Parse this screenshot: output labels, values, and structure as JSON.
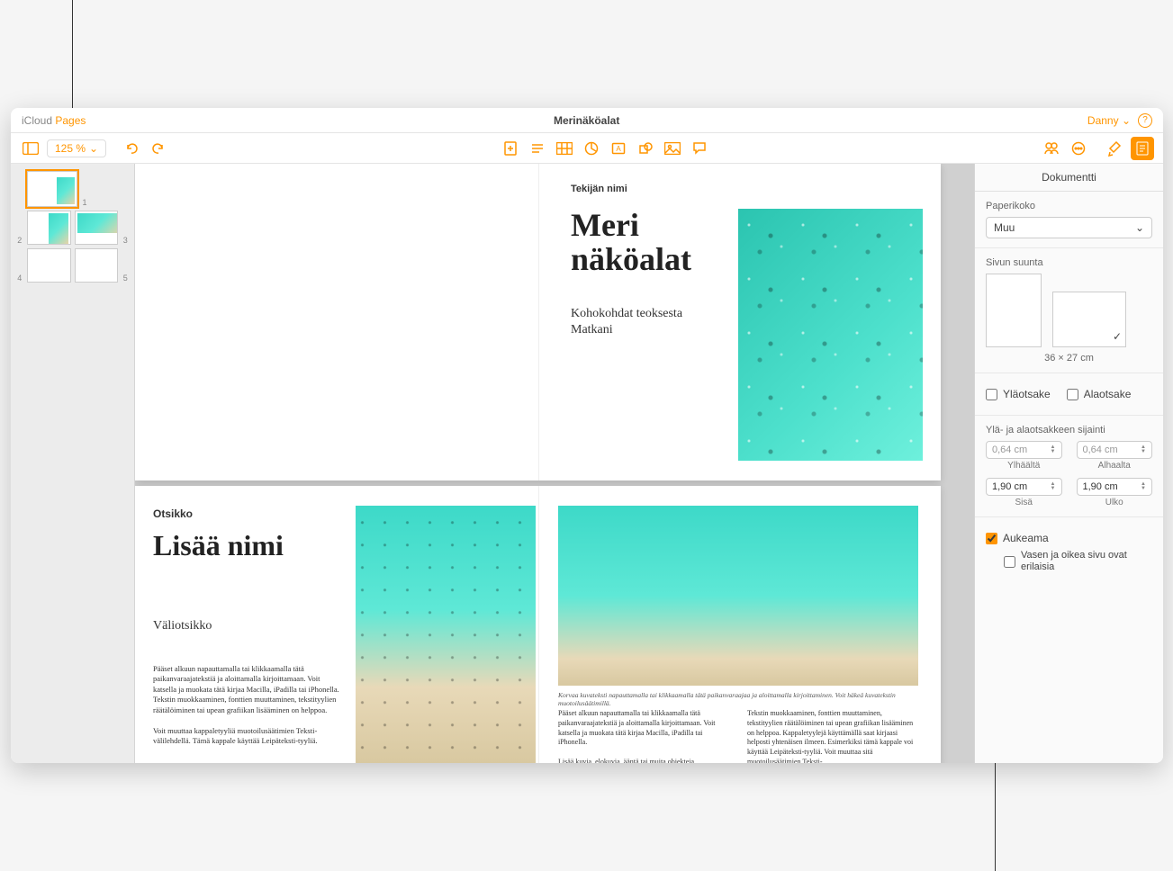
{
  "titlebar": {
    "app_prefix": "iCloud",
    "app_name": "Pages",
    "document_title": "Merinäköalat",
    "user": "Danny"
  },
  "toolbar": {
    "zoom": "125 %"
  },
  "thumbnails": {
    "pages": [
      "1",
      "2",
      "3",
      "4",
      "5"
    ]
  },
  "spread1": {
    "author_label": "Tekijän nimi",
    "title_line1": "Meri",
    "title_line2": "näköalat",
    "subtitle_line1": "Kohokohdat teoksesta",
    "subtitle_line2": "Matkani"
  },
  "spread2": {
    "heading_label": "Otsikko",
    "title": "Lisää nimi",
    "subtitle": "Väliotsikko",
    "body_p1": "Pääset alkuun napauttamalla tai klikkaamalla tätä paikanvaraajatekstiä ja aloittamalla kirjoittamaan. Voit katsella ja muokata tätä kirjaa Macilla, iPadilla tai iPhonella. Tekstin muokkaaminen, fonttien muuttaminen, tekstityylien räätälöiminen tai upean grafiikan lisääminen on helppoa.",
    "body_p2": "Voit muuttaa kappaletyyliä muotoilusäätimien Teksti-välilehdellä. Tämä kappale käyttää Leipäteksti-tyyliä.",
    "caption": "Korvaa kuvateksti napauttamalla tai klikkaamalla tätä paikanvaraajaa ja aloittamalla kirjoittaminen. Voit häkeä kuvatekstin muotoilusäätimillä.",
    "col1_p1": "Pääset alkuun napauttamalla tai klikkaamalla tätä paikanvaraajatekstiä ja aloittamalla kirjoittamaan. Voit katsella ja muokata tätä kirjaa Macilla, iPadilla tai iPhonella.",
    "col1_p2": "Lisää kuvia, elokuvia, ääntä tai muita objekteja",
    "col2": "Tekstin muokkaaminen, fonttien muuttaminen, tekstityylien räätälöiminen tai upean grafiikan lisääminen on helppoa. Kappaletyylejä käyttämällä saat kirjaasi helposti yhtenäisen ilmeen. Esimerkiksi tämä kappale voi käyttää Leipäteksti-tyyliä. Voit muuttaa sitä muotoilusäätimien Teksti-"
  },
  "inspector": {
    "tab": "Dokumentti",
    "paper_size_label": "Paperikoko",
    "paper_size_value": "Muu",
    "orientation_label": "Sivun suunta",
    "dimensions": "36 × 27 cm",
    "header_label": "Yläotsake",
    "footer_label": "Alaotsake",
    "hf_position_label": "Ylä- ja alaotsakkeen sijainti",
    "top_value": "0,64 cm",
    "top_label": "Ylhäältä",
    "bottom_value": "0,64 cm",
    "bottom_label": "Alhaalta",
    "inside_value": "1,90 cm",
    "inside_label": "Sisä",
    "outside_value": "1,90 cm",
    "outside_label": "Ulko",
    "facing_label": "Aukeama",
    "diff_label": "Vasen ja oikea sivu ovat erilaisia"
  }
}
